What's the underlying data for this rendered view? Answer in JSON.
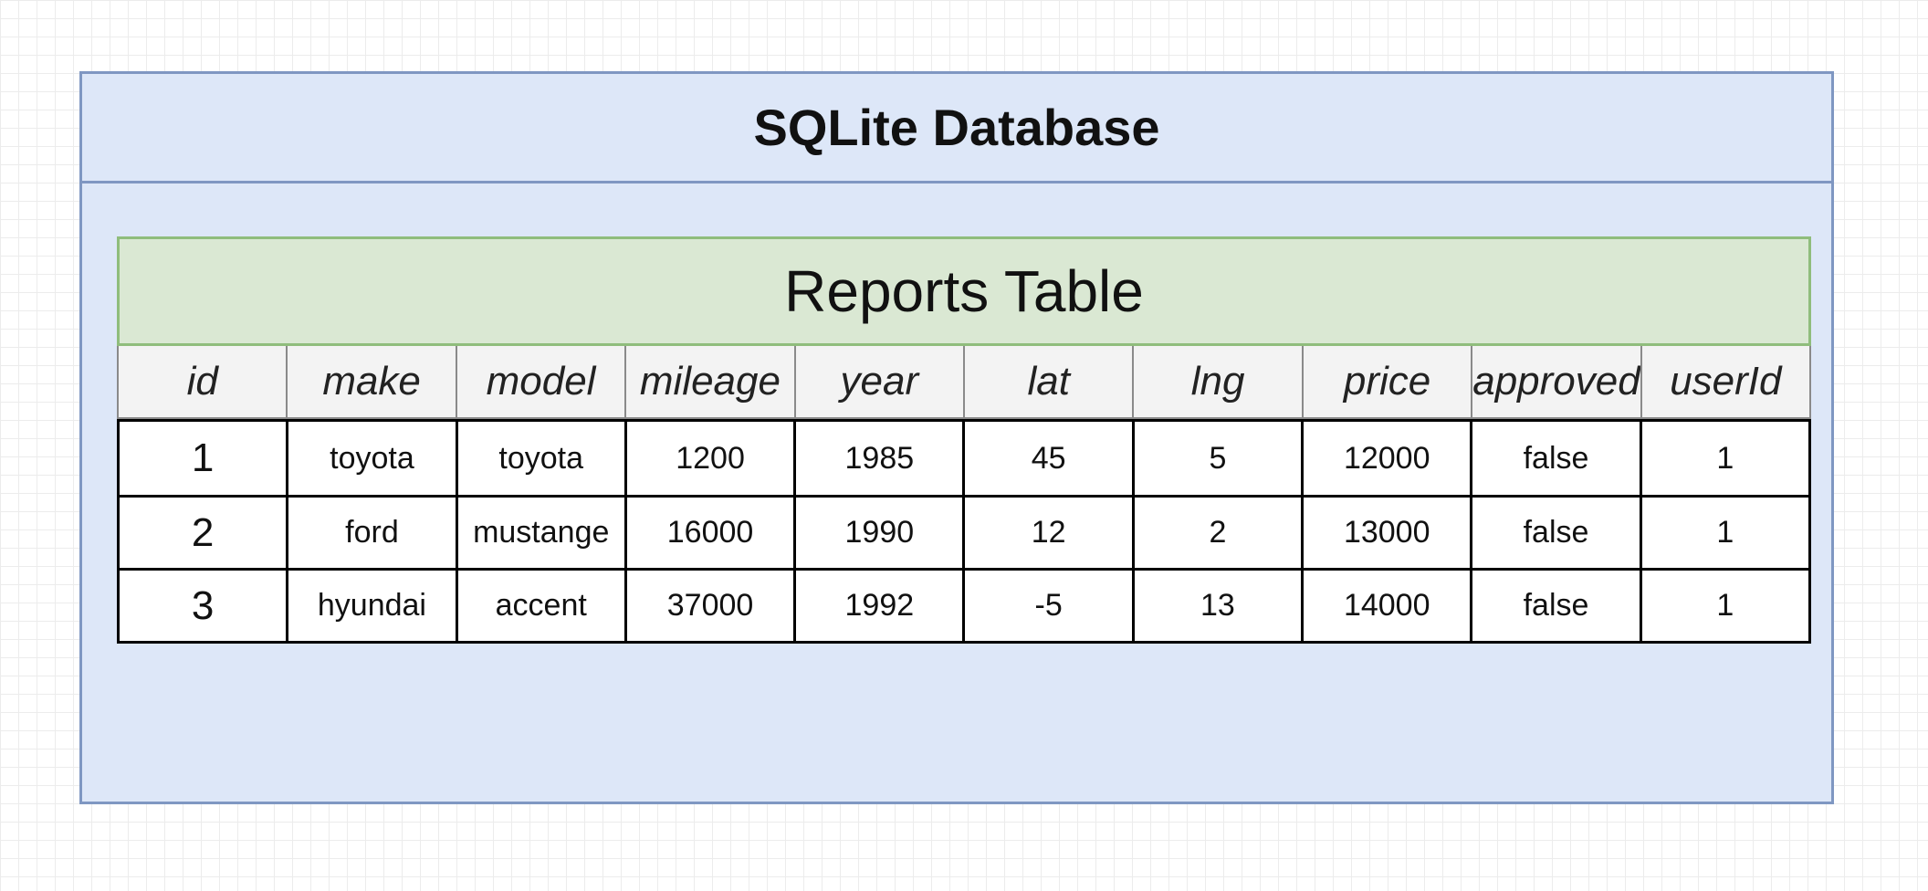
{
  "database": {
    "title": "SQLite Database"
  },
  "table": {
    "title": "Reports Table",
    "columns": [
      "id",
      "make",
      "model",
      "mileage",
      "year",
      "lat",
      "lng",
      "price",
      "approved",
      "userId"
    ],
    "rows": [
      [
        "1",
        "toyota",
        "toyota",
        "1200",
        "1985",
        "45",
        "5",
        "12000",
        "false",
        "1"
      ],
      [
        "2",
        "ford",
        "mustange",
        "16000",
        "1990",
        "12",
        "2",
        "13000",
        "false",
        "1"
      ],
      [
        "3",
        "hyundai",
        "accent",
        "37000",
        "1992",
        "-5",
        "13",
        "14000",
        "false",
        "1"
      ]
    ]
  },
  "colors": {
    "database_fill": "#dde7f8",
    "database_border": "#7f97c2",
    "table_title_fill": "#dae8d3",
    "table_title_border": "#8fbd7c"
  }
}
